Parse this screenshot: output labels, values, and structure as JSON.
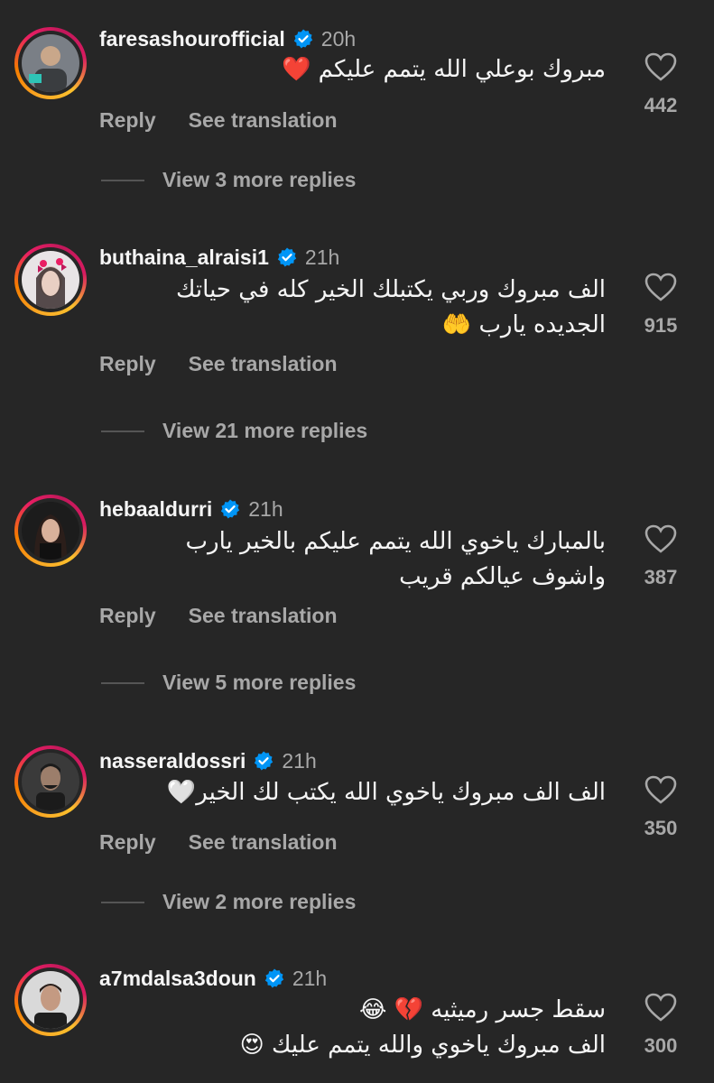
{
  "comments": [
    {
      "username": "faresashourofficial",
      "time": "20h",
      "text_lines": [
        "مبروك بوعلي الله يتمم عليكم ❤️"
      ],
      "likes": "442",
      "reply_label": "Reply",
      "translate_label": "See translation",
      "view_replies": "View 3 more replies"
    },
    {
      "username": "buthaina_alraisi1",
      "time": "21h",
      "text_lines": [
        "الف مبروك وربي يكتبلك الخير كله في حياتك",
        "الجديده يارب 🤲"
      ],
      "likes": "915",
      "reply_label": "Reply",
      "translate_label": "See translation",
      "view_replies": "View 21 more replies"
    },
    {
      "username": "hebaaldurri",
      "time": "21h",
      "text_lines": [
        "بالمبارك ياخوي الله يتمم عليكم بالخير يارب",
        "واشوف عيالكم قريب"
      ],
      "likes": "387",
      "reply_label": "Reply",
      "translate_label": "See translation",
      "view_replies": "View 5 more replies"
    },
    {
      "username": "nasseraldossri",
      "time": "21h",
      "text_lines": [
        "الف الف مبروك ياخوي الله يكتب لك الخير🤍"
      ],
      "likes": "350",
      "reply_label": "Reply",
      "translate_label": "See translation",
      "view_replies": "View 2 more replies"
    },
    {
      "username": "a7mdalsa3doun",
      "time": "21h",
      "text_lines": [
        "سقط جسر رميثيه 💔 😂",
        "الف مبروك ياخوي والله يتمم عليك 😍"
      ],
      "likes": "300"
    }
  ],
  "colors": {
    "background": "#262626",
    "text_primary": "#f5f5f5",
    "text_secondary": "#a8a8a8",
    "verified_blue": "#0095f6"
  },
  "icons": {
    "verified": "verified-badge-icon",
    "like": "heart-outline-icon"
  }
}
